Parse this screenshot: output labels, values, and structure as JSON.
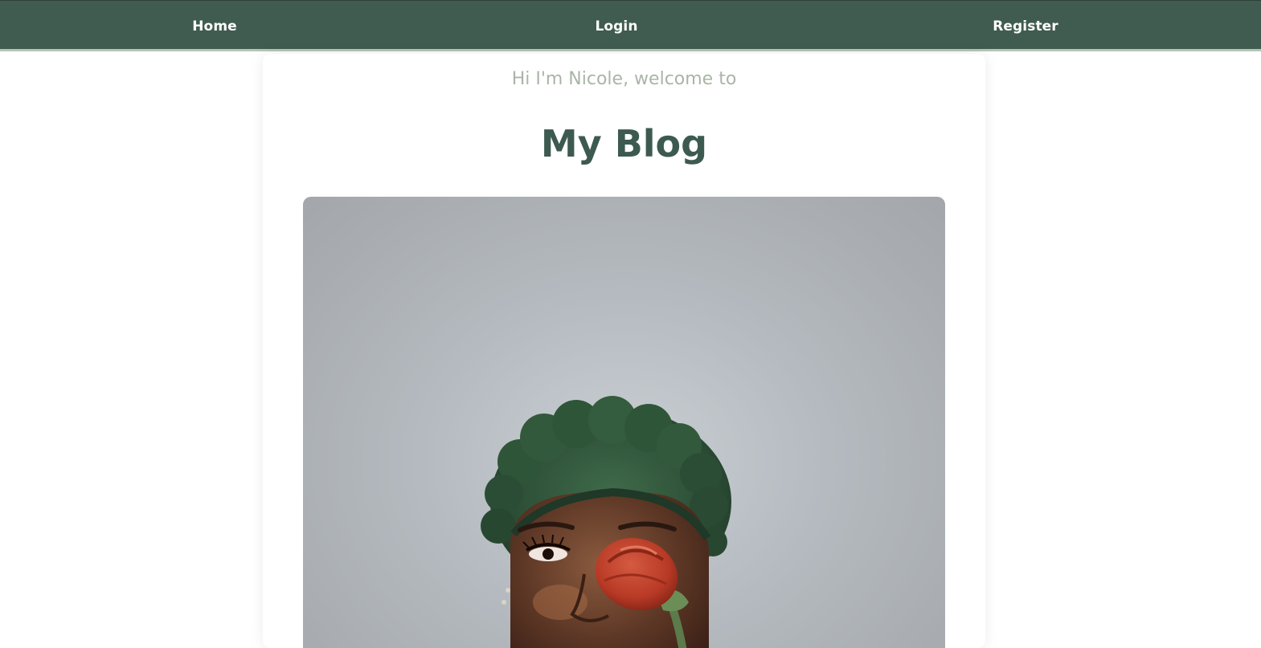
{
  "nav": {
    "home": "Home",
    "login": "Login",
    "register": "Register"
  },
  "intro": {
    "greeting": "Hi I'm Nicole, welcome to",
    "title": "My Blog"
  },
  "hero": {
    "alt": "Woman with green hair holding a red rose over one eye"
  },
  "colors": {
    "nav_background": "#405c51",
    "nav_underline": "#b6c5b4",
    "title": "#3d5a51",
    "greeting": "#a9b5a7",
    "page_background": "#ffffff"
  }
}
